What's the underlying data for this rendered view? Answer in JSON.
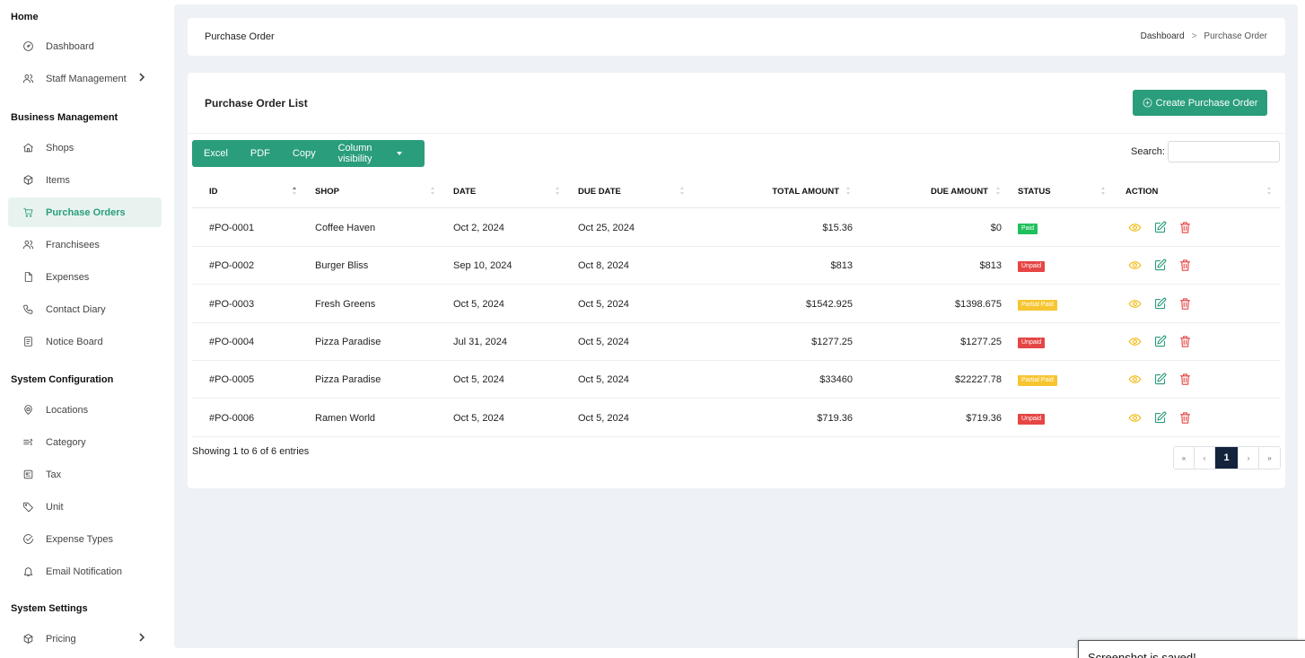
{
  "sidebar": {
    "sections": [
      {
        "title": "Home",
        "items": [
          {
            "label": "Dashboard",
            "icon": "dashboard-gauge-icon",
            "chevron": false,
            "active": false
          },
          {
            "label": "Staff Management",
            "icon": "users-icon",
            "chevron": true,
            "active": false
          }
        ]
      },
      {
        "title": "Business Management",
        "items": [
          {
            "label": "Shops",
            "icon": "home-icon",
            "chevron": false,
            "active": false
          },
          {
            "label": "Items",
            "icon": "box-icon",
            "chevron": false,
            "active": false
          },
          {
            "label": "Purchase Orders",
            "icon": "cart-icon",
            "chevron": false,
            "active": true
          },
          {
            "label": "Franchisees",
            "icon": "users-icon",
            "chevron": false,
            "active": false
          },
          {
            "label": "Expenses",
            "icon": "file-icon",
            "chevron": false,
            "active": false
          },
          {
            "label": "Contact Diary",
            "icon": "phone-icon",
            "chevron": false,
            "active": false
          },
          {
            "label": "Notice Board",
            "icon": "notice-icon",
            "chevron": false,
            "active": false
          }
        ]
      },
      {
        "title": "System Configuration",
        "items": [
          {
            "label": "Locations",
            "icon": "location-pin-icon",
            "chevron": false,
            "active": false
          },
          {
            "label": "Category",
            "icon": "category-icon",
            "chevron": false,
            "active": false
          },
          {
            "label": "Tax",
            "icon": "tax-icon",
            "chevron": false,
            "active": false
          },
          {
            "label": "Unit",
            "icon": "tag-icon",
            "chevron": false,
            "active": false
          },
          {
            "label": "Expense Types",
            "icon": "check-circle-icon",
            "chevron": false,
            "active": false
          },
          {
            "label": "Email Notification",
            "icon": "bell-icon",
            "chevron": false,
            "active": false
          }
        ]
      },
      {
        "title": "System Settings",
        "items": [
          {
            "label": "Pricing",
            "icon": "box-icon",
            "chevron": true,
            "active": false
          }
        ]
      }
    ]
  },
  "header": {
    "title": "Purchase Order",
    "breadcrumb": {
      "root": "Dashboard",
      "separator": ">",
      "current": "Purchase Order"
    }
  },
  "card": {
    "title": "Purchase Order List",
    "create_button": "Create Purchase Order",
    "export_buttons": [
      "Excel",
      "PDF",
      "Copy",
      "Column visibility"
    ],
    "search_label": "Search:",
    "search_value": ""
  },
  "table": {
    "columns": [
      "ID",
      "SHOP",
      "DATE",
      "DUE DATE",
      "TOTAL AMOUNT",
      "DUE AMOUNT",
      "STATUS",
      "ACTION"
    ],
    "rows": [
      {
        "id": "#PO-0001",
        "shop": "Coffee Haven",
        "date": "Oct 2, 2024",
        "due_date": "Oct 25, 2024",
        "total": "$15.36",
        "due": "$0",
        "status": "Paid",
        "status_type": "paid"
      },
      {
        "id": "#PO-0002",
        "shop": "Burger Bliss",
        "date": "Sep 10, 2024",
        "due_date": "Oct 8, 2024",
        "total": "$813",
        "due": "$813",
        "status": "Unpaid",
        "status_type": "unpaid"
      },
      {
        "id": "#PO-0003",
        "shop": "Fresh Greens",
        "date": "Oct 5, 2024",
        "due_date": "Oct 5, 2024",
        "total": "$1542.925",
        "due": "$1398.675",
        "status": "Partial Paid",
        "status_type": "partial"
      },
      {
        "id": "#PO-0004",
        "shop": "Pizza Paradise",
        "date": "Jul 31, 2024",
        "due_date": "Oct 5, 2024",
        "total": "$1277.25",
        "due": "$1277.25",
        "status": "Unpaid",
        "status_type": "unpaid"
      },
      {
        "id": "#PO-0005",
        "shop": "Pizza Paradise",
        "date": "Oct 5, 2024",
        "due_date": "Oct 5, 2024",
        "total": "$33460",
        "due": "$22227.78",
        "status": "Partial Paid",
        "status_type": "partial"
      },
      {
        "id": "#PO-0006",
        "shop": "Ramen World",
        "date": "Oct 5, 2024",
        "due_date": "Oct 5, 2024",
        "total": "$719.36",
        "due": "$719.36",
        "status": "Unpaid",
        "status_type": "unpaid"
      }
    ],
    "info": "Showing 1 to 6 of 6 entries",
    "pagination": [
      "«",
      "‹",
      "1",
      "›",
      "»"
    ],
    "current_page": "1"
  },
  "colors": {
    "accent": "#2a9d7c",
    "paid": "#20c05c",
    "unpaid": "#e64545",
    "partial": "#f7c530",
    "view_icon": "#f2b705",
    "edit_icon": "#2a9d7c",
    "delete_icon": "#e64545",
    "pager_active": "#14233c"
  },
  "toast": {
    "text": "Screenshot is saved!"
  }
}
